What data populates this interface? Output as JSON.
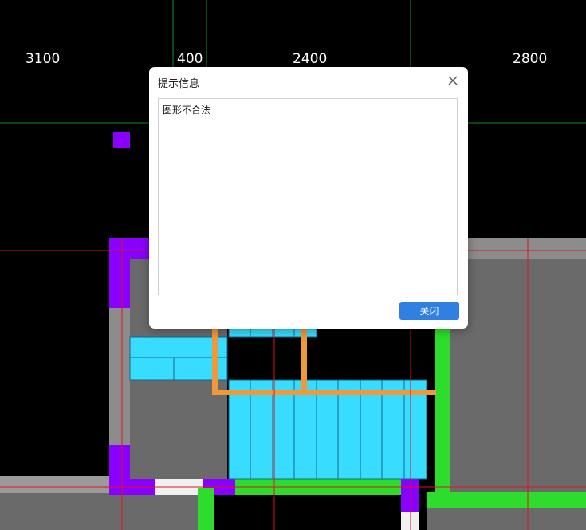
{
  "canvas": {
    "dimensions": [
      "3100",
      "400",
      "2400",
      "2800"
    ]
  },
  "dialog": {
    "title": "提示信息",
    "message": "图形不合法",
    "close_button_label": "关闭",
    "close_icon": "close-icon",
    "accent_color": "#2f80e0"
  },
  "colors": {
    "background": "#000000",
    "cyan_fill": "#38dcff",
    "purple": "#8a00ff",
    "green": "#2ddc2d",
    "orange": "#f0983c",
    "gray": "#6e6e6e",
    "red_line": "#e0141e",
    "green_line": "#1f8a2a"
  }
}
